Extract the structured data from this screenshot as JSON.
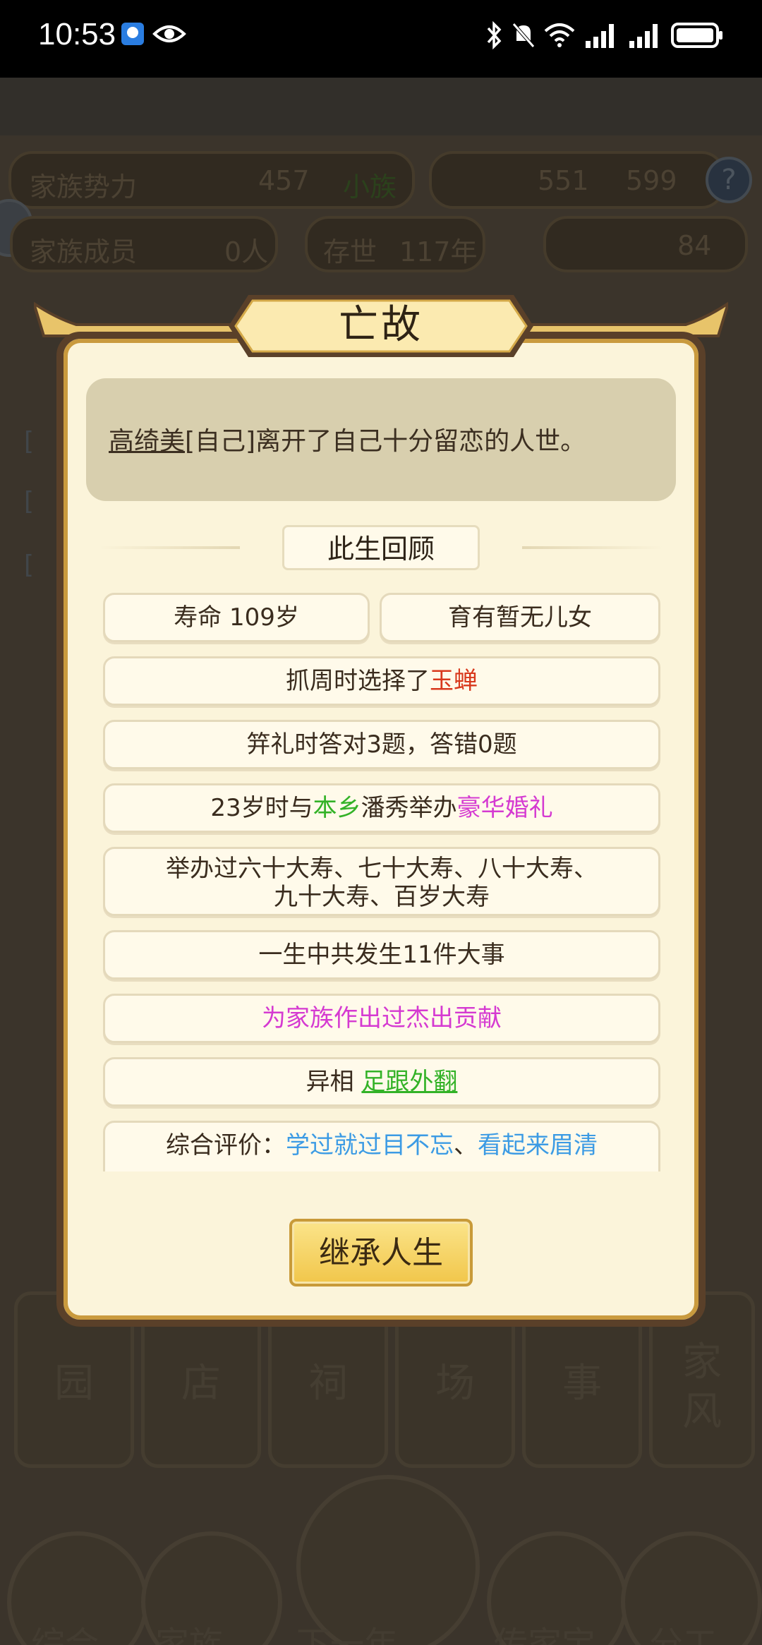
{
  "status_bar": {
    "time": "10:53",
    "icons": [
      "app-notification-icon",
      "eye-icon",
      "bluetooth-icon",
      "mute-icon",
      "wifi-icon",
      "signal-icon",
      "signal-icon",
      "battery-icon"
    ]
  },
  "background": {
    "family_power_label": "家族势力",
    "family_power_value": "457",
    "family_power_rank": "小族",
    "resource_a": "551",
    "resource_b": "599",
    "members_label": "家族成员",
    "members_value": "0人",
    "years_label": "存世",
    "years_value": "117年",
    "gold_value": "84",
    "tiles": [
      "园",
      "店",
      "祠",
      "场",
      "事",
      "风"
    ],
    "tile_top": "家",
    "nav": [
      "综合",
      "家族",
      "下一年",
      "传家宝",
      "分工"
    ]
  },
  "dialog": {
    "title": "亡故",
    "message_name": "高绮美",
    "message_rest": "[自己]离开了自己十分留恋的人世。",
    "review_title": "此生回顾",
    "lifespan": "寿命 109岁",
    "children": "育有暂无儿女",
    "zhuazhou_prefix": "抓周时选择了",
    "zhuazhou_item": "玉蝉",
    "jili": "笄礼时答对3题，答错0题",
    "wedding_prefix": "23岁时与",
    "wedding_place": "本乡",
    "wedding_mid": "潘秀举办",
    "wedding_type": "豪华婚礼",
    "birthday_line1": "举办过六十大寿、七十大寿、八十大寿、",
    "birthday_line2": "九十大寿、百岁大寿",
    "events": "一生中共发生11件大事",
    "contribution": "为家族作出过杰出贡献",
    "trait_prefix": "异相 ",
    "trait": "足跟外翻",
    "eval_prefix": "综合评价：",
    "eval_a": "学过就过目不忘",
    "eval_sep": "、",
    "eval_b": "看起来眉清",
    "inherit_button": "继承人生"
  },
  "colors": {
    "dialog_bg": "#fbf4da",
    "highlight_red": "#d8381c",
    "highlight_green": "#33b227",
    "highlight_magenta": "#d53ad1",
    "highlight_blue": "#3c9be4"
  }
}
